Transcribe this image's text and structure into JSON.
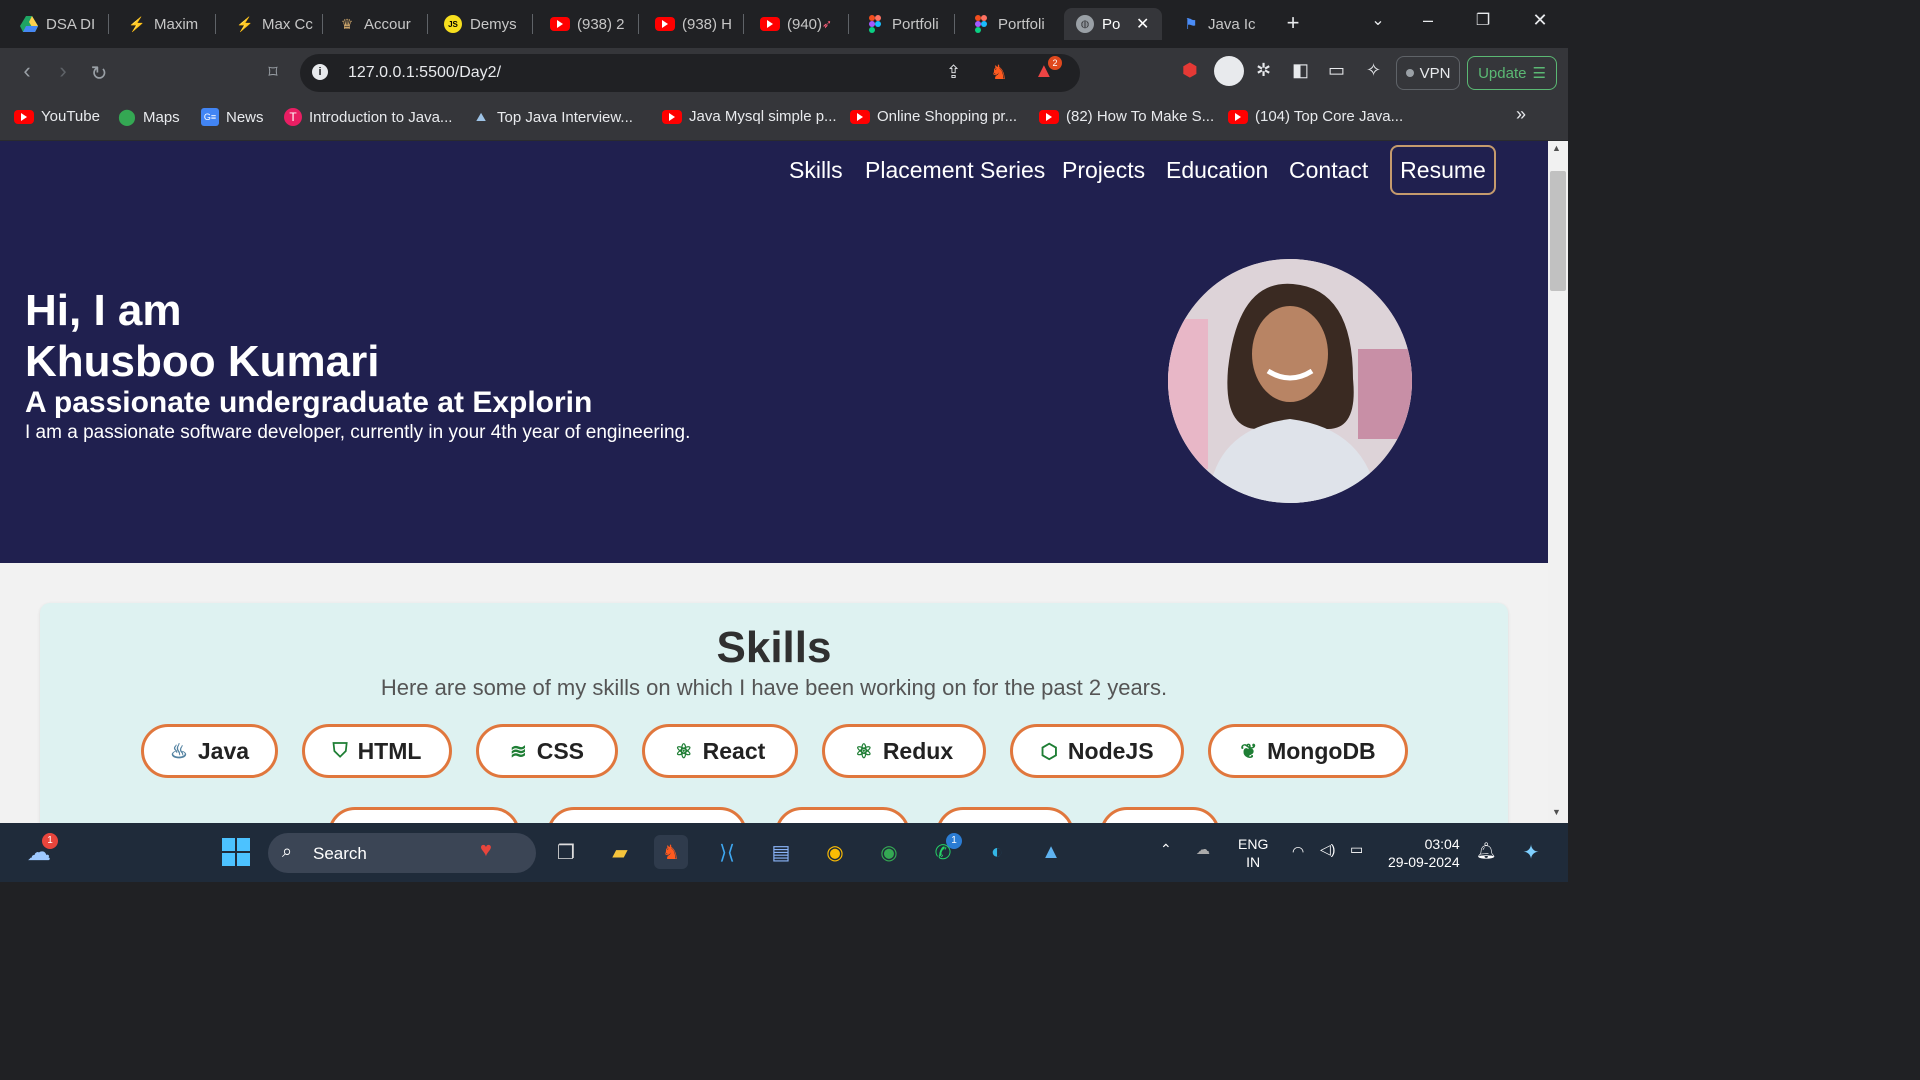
{
  "browser": {
    "tabs": [
      {
        "label": "DSA DI",
        "icon": "drive-icon"
      },
      {
        "label": "Maxim",
        "icon": "codeforces-icon"
      },
      {
        "label": "Max Cc",
        "icon": "codeforces-icon"
      },
      {
        "label": "Accour",
        "icon": "account-icon"
      },
      {
        "label": "Demys",
        "icon": "js-icon"
      },
      {
        "label": "(938) 2",
        "icon": "youtube-icon"
      },
      {
        "label": "(938) H",
        "icon": "youtube-icon"
      },
      {
        "label": "(940) ",
        "icon": "youtube-icon"
      },
      {
        "label": "Portfoli",
        "icon": "figma-icon"
      },
      {
        "label": "Portfoli",
        "icon": "figma-icon"
      },
      {
        "label": "Po",
        "icon": "globe-icon"
      },
      {
        "label": "Java Ic",
        "icon": "flag-icon"
      }
    ],
    "url": "127.0.0.1:5500/Day2/",
    "vpn_label": "VPN",
    "update_label": "Update",
    "brave_badge": "2",
    "bookmarks": [
      "YouTube",
      "Maps",
      "News",
      "Introduction to Java...",
      "Top Java Interview...",
      "Java Mysql simple p...",
      "Online Shopping pr...",
      "(82) How To Make S...",
      "(104) Top Core Java..."
    ]
  },
  "site": {
    "nav": [
      "Skills",
      "Placement Series",
      "Projects",
      "Education",
      "Contact"
    ],
    "resume": "Resume",
    "greeting": "Hi, I am",
    "name": "Khusboo Kumari",
    "tagline": "A passionate undergraduate at Explorin",
    "description": "I am a passionate software developer, currently in your 4th year of engineering.",
    "skills_title": "Skills",
    "skills_subtitle": "Here are some of my skills on which I have been working on for the past 2 years.",
    "skills": [
      {
        "label": "Java",
        "icon": "java-icon",
        "color": "#5382a1"
      },
      {
        "label": "HTML",
        "icon": "html5-icon",
        "color": "#1e7e34"
      },
      {
        "label": "CSS",
        "icon": "css3-icon",
        "color": "#1e7e34"
      },
      {
        "label": "React",
        "icon": "react-icon",
        "color": "#1e7e34"
      },
      {
        "label": "Redux",
        "icon": "redux-icon",
        "color": "#1e7e34"
      },
      {
        "label": "NodeJS",
        "icon": "nodejs-icon",
        "color": "#1e7e34"
      },
      {
        "label": "MongoDB",
        "icon": "mongodb-icon",
        "color": "#1e7e34"
      }
    ],
    "colors": {
      "hero_bg": "#20204f",
      "accent_border": "#e0773d",
      "resume_border": "#c59b6d",
      "card_bg": "#def2f1"
    }
  },
  "taskbar": {
    "search_placeholder": "Search",
    "weather_badge": "1",
    "whatsapp_badge": "1",
    "lang_top": "ENG",
    "lang_bottom": "IN",
    "time": "03:04",
    "date": "29-09-2024"
  }
}
